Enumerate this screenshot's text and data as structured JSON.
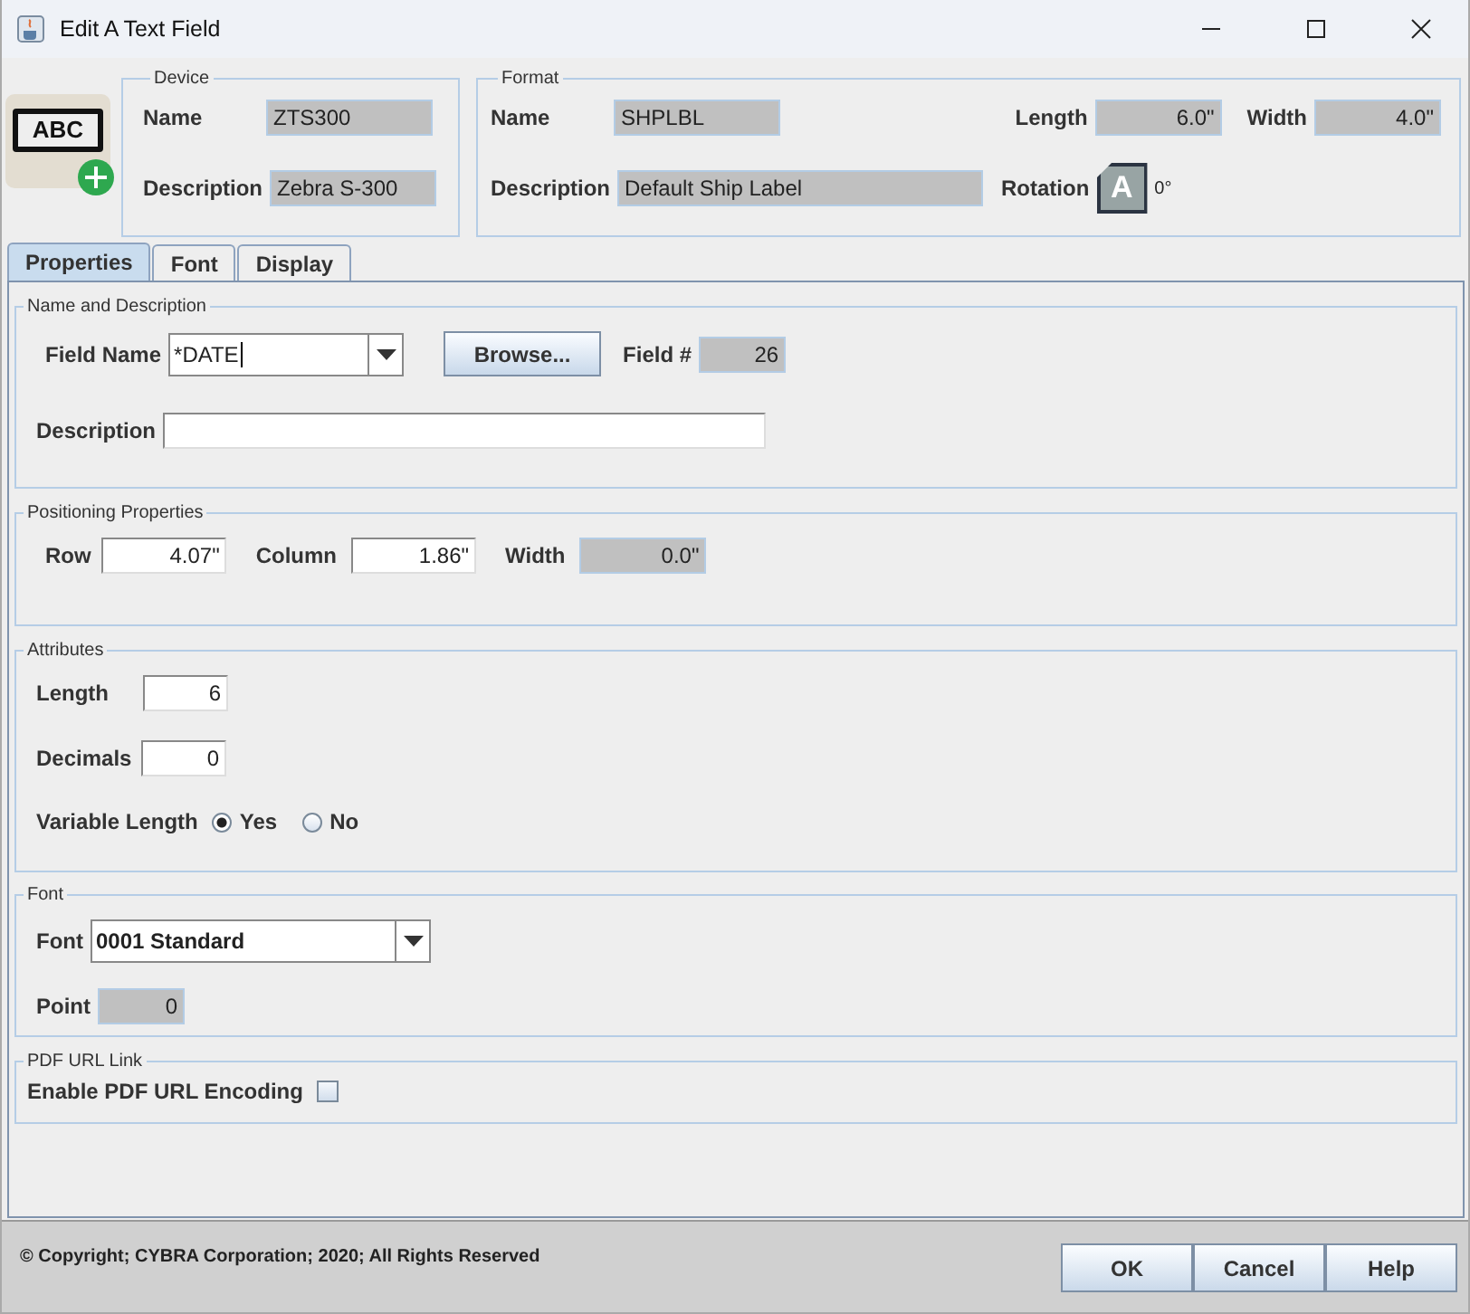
{
  "window": {
    "title": "Edit A Text Field"
  },
  "field_icon": {
    "text": "ABC"
  },
  "device": {
    "legend": "Device",
    "name": {
      "label": "Name",
      "value": "ZTS300",
      "readonly": true
    },
    "description": {
      "label": "Description",
      "value": "Zebra S-300",
      "readonly": true
    }
  },
  "format": {
    "legend": "Format",
    "name": {
      "label": "Name",
      "value": "SHPLBL",
      "readonly": true
    },
    "length": {
      "label": "Length",
      "value": "6.0\"",
      "readonly": true
    },
    "width": {
      "label": "Width",
      "value": "4.0\"",
      "readonly": true
    },
    "description": {
      "label": "Description",
      "value": "Default Ship Label",
      "readonly": true
    },
    "rotation": {
      "label": "Rotation",
      "glyph": "A",
      "value": "0°"
    }
  },
  "tabs": [
    {
      "label": "Properties",
      "selected": true
    },
    {
      "label": "Font",
      "selected": false
    },
    {
      "label": "Display",
      "selected": false
    }
  ],
  "name_and_description": {
    "legend": "Name and Description",
    "field_name": {
      "label": "Field Name",
      "value": "*DATE"
    },
    "browse_button": "Browse...",
    "field_number": {
      "label": "Field #",
      "value": "26",
      "readonly": true
    },
    "description": {
      "label": "Description",
      "readonly": false
    }
  },
  "positioning": {
    "legend": "Positioning Properties",
    "row": {
      "label": "Row",
      "value": "4.07\"",
      "readonly": false
    },
    "column": {
      "label": "Column",
      "value": "1.86\"",
      "readonly": false
    },
    "width": {
      "label": "Width",
      "value": "0.0\"",
      "readonly": true
    }
  },
  "attributes": {
    "legend": "Attributes",
    "length": {
      "label": "Length",
      "value": "6",
      "readonly": false
    },
    "decimals": {
      "label": "Decimals",
      "value": "0",
      "readonly": false
    },
    "variable_length": {
      "label": "Variable Length",
      "options": [
        {
          "label": "Yes",
          "selected": true
        },
        {
          "label": "No",
          "selected": false
        }
      ]
    }
  },
  "font": {
    "legend": "Font",
    "font": {
      "label": "Font",
      "value": "0001 Standard"
    },
    "point": {
      "label": "Point",
      "value": "0",
      "readonly": true
    }
  },
  "pdf_url_link": {
    "legend": "PDF URL Link",
    "enable": {
      "label": "Enable PDF URL Encoding",
      "checked": false
    }
  },
  "footer": {
    "copyright": "© Copyright; CYBRA Corporation; 2020; All Rights Reserved",
    "buttons": [
      "OK",
      "Cancel",
      "Help"
    ]
  }
}
